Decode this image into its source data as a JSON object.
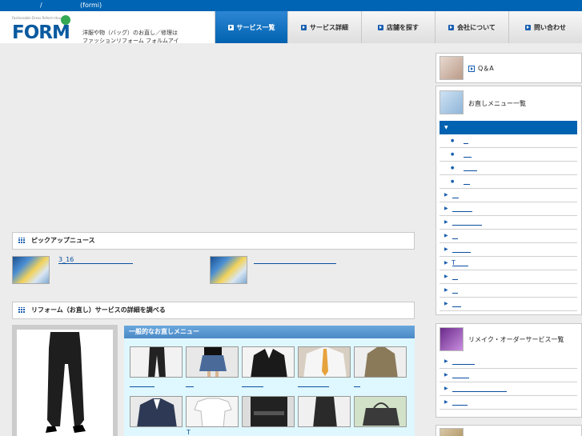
{
  "topbar": {
    "slash": "/",
    "title": "(formi)"
  },
  "logo": {
    "tiny": "Fashionable Dress Reform House",
    "word": "FORM"
  },
  "tagline": {
    "line1": "洋服や物（バッグ）のお直し／修理は",
    "line2": "ファッションリフォーム フォルムアイ"
  },
  "nav": [
    {
      "label": "サービス一覧",
      "active": true
    },
    {
      "label": "サービス詳細",
      "active": false
    },
    {
      "label": "店舗を探す",
      "active": false
    },
    {
      "label": "会社について",
      "active": false
    },
    {
      "label": "問い合わせ",
      "active": false
    }
  ],
  "pickup": {
    "title": "ピックアップニュース",
    "items": [
      {
        "text": "3_16"
      },
      {
        "text": ""
      }
    ]
  },
  "reform": {
    "title": "リフォーム（お直し）サービスの詳細を調べる",
    "menu_title": "一般的なお直しメニュー",
    "thumbs_row2_label": "T"
  },
  "sidebar": {
    "qa": "Q＆A",
    "menu_list_title": "お直しメニュー一覧",
    "menu_head_arrow": "▼",
    "remake_title": "リメイク・オーダーサービス一覧",
    "t_label": "T"
  },
  "colors": {
    "brand_blue": "#0064b4",
    "logo_green": "#34a853",
    "panel_bg": "#dff8ff"
  }
}
